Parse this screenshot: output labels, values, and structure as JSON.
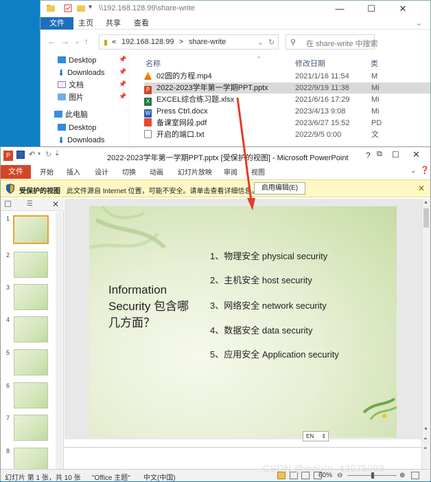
{
  "explorer": {
    "path_title": "\\\\192.168.128.99\\share-write",
    "ribbon_tabs": [
      "文件",
      "主页",
      "共享",
      "查看"
    ],
    "breadcrumb": [
      "«",
      "192.168.128.99",
      ">",
      "share-write"
    ],
    "search_placeholder": "在 share-write 中搜索",
    "nav_items": [
      "Desktop",
      "Downloads",
      "文档",
      "图片",
      "此电脑",
      "Desktop",
      "Downloads"
    ],
    "columns": {
      "name": "名称",
      "date": "修改日期",
      "type": "类"
    },
    "files": [
      {
        "name": "02圆的方程.mp4",
        "date": "2021/1/16 11:54",
        "type": "M"
      },
      {
        "name": "2022-2023学年第一学期PPT.pptx",
        "date": "2022/9/19 11:38",
        "type": "Mi"
      },
      {
        "name": "EXCEL综合练习题.xlsx",
        "date": "2021/6/16 17:29",
        "type": "Mi"
      },
      {
        "name": "Press Ctrl.docx",
        "date": "2023/4/13 9:08",
        "type": "Mi"
      },
      {
        "name": "备课室网段.pdf",
        "date": "2023/6/27 15:52",
        "type": "PD"
      },
      {
        "name": "开启的端口.txt",
        "date": "2022/9/5 0:00",
        "type": "文"
      }
    ],
    "win_minimize": "—",
    "win_maximize": "☐",
    "win_close": "✕"
  },
  "ppt": {
    "caption": "2022-2023学年第一学期PPT.pptx [受保护的视图] - Microsoft PowerPoint",
    "tabs": [
      "文件",
      "开始",
      "插入",
      "设计",
      "切换",
      "动画",
      "幻灯片放映",
      "审阅",
      "视图"
    ],
    "protected_label": "受保护的视图",
    "protected_msg": "此文件源自 Internet 位置，可能不安全。请单击查看详细信息。",
    "enable_edit": "启用编辑(E)",
    "help": "?",
    "slide_numbers": [
      "1",
      "2",
      "3",
      "4",
      "5",
      "6",
      "7",
      "8"
    ],
    "slide": {
      "title": "Information Security 包含哪几方面？",
      "items": [
        "1、物理安全 physical  security",
        "2、主机安全 host  security",
        "3、网络安全 network  security",
        "4、数据安全  data security",
        "5、应用安全 Application  security"
      ]
    },
    "ime": "EN",
    "status": {
      "slide_info": "幻灯片 第 1 张，共 10 张",
      "theme": "\"Office 主题\"",
      "lang": "中文(中国)",
      "zoom": "60%"
    }
  },
  "watermark": "CSDN @weixin_43075093",
  "colors": {
    "accent": "#1b6fbe",
    "ppt_file": "#d24726",
    "arrow": "#e53a2a"
  }
}
